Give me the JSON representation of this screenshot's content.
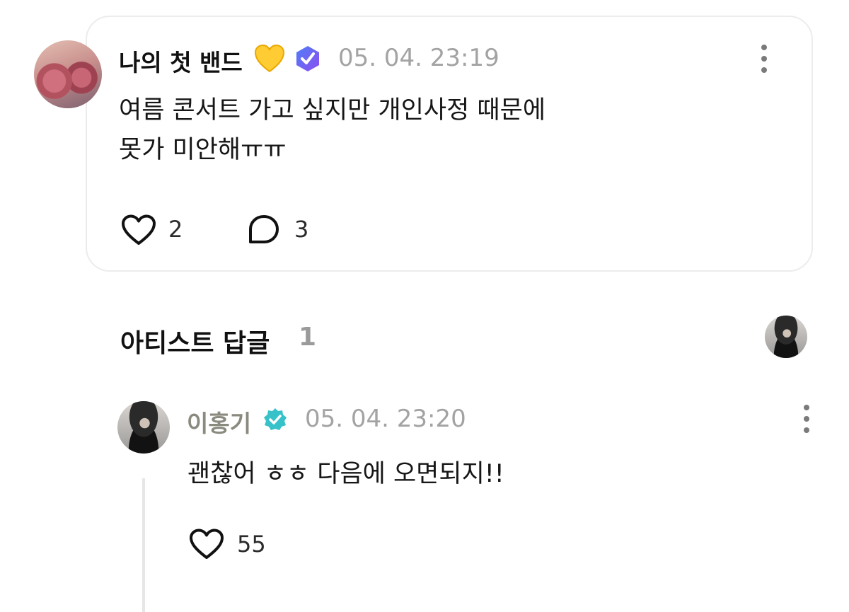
{
  "post": {
    "username": "나의 첫 밴드",
    "timestamp": "05. 04. 23:19",
    "text": "여름 콘서트 가고 싶지만 개인사정 때문에\n못가 미안해ㅠㅠ",
    "likes": "2",
    "comments": "3"
  },
  "artist_section": {
    "title": "아티스트 답글",
    "count": "1"
  },
  "reply": {
    "username": "이홍기",
    "timestamp": "05. 04. 23:20",
    "text": "괜찮어 ㅎㅎ 다음에 오면되지!!",
    "likes": "55"
  },
  "icons": {
    "heart_emoji": "yellow-heart-emoji",
    "verified_badge": "purple-verified-badge",
    "artist_badge": "teal-verified-badge",
    "like": "heart-outline-icon",
    "comment": "speech-bubble-icon",
    "more": "vertical-ellipsis-icon"
  },
  "colors": {
    "badge_purple": "#6b5cf6",
    "badge_teal": "#37c1c8",
    "timestamp": "#a3a3a3",
    "artist_name": "#8b8a7f"
  }
}
